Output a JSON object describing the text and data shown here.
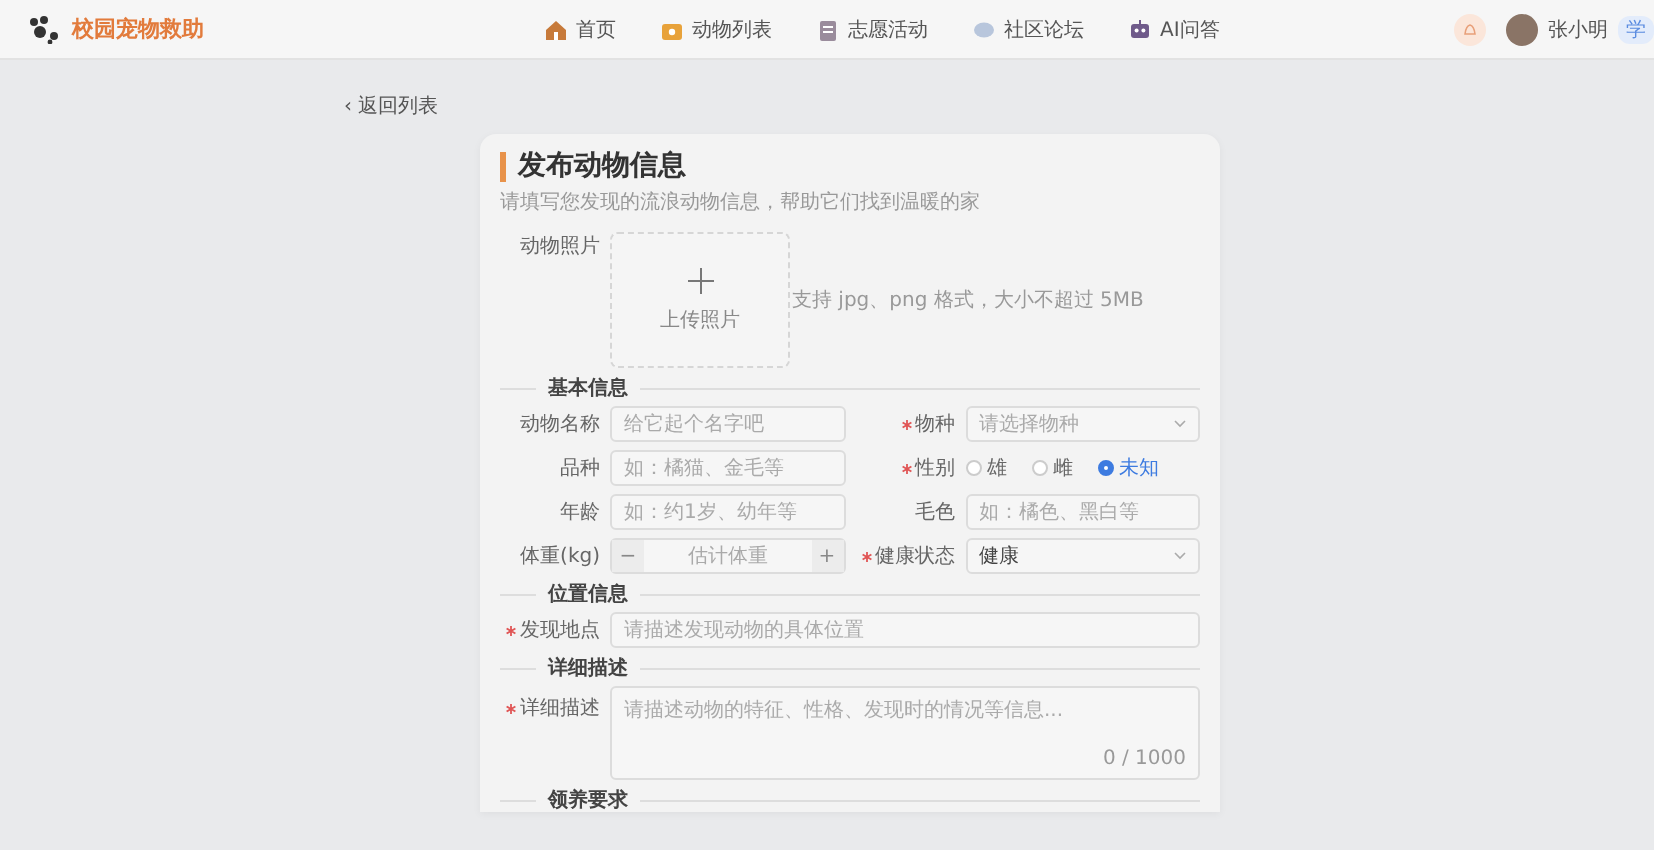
{
  "header": {
    "logo_text": "校园宠物救助",
    "nav": [
      {
        "label": "首页",
        "selected": false
      },
      {
        "label": "动物列表",
        "selected": false
      },
      {
        "label": "志愿活动",
        "selected": false
      },
      {
        "label": "社区论坛",
        "selected": false
      },
      {
        "label": "AI问答",
        "selected": false
      }
    ],
    "user_name": "张小明",
    "role_tag": "学"
  },
  "back_link": "‹ 返回列表",
  "form": {
    "title": "发布动物信息",
    "subtitle": "请填写您发现的流浪动物信息，帮助它们找到温暖的家",
    "photo": {
      "label": "动物照片",
      "upload_text": "上传照片",
      "hint": "支持 jpg、png 格式，大小不超过 5MB"
    },
    "sections": [
      {
        "title": "基本信息",
        "fields": [
          {
            "kind": "text",
            "label": "动物名称",
            "required": false,
            "placeholder": "给它起个名字吧"
          },
          {
            "kind": "select",
            "label": "物种",
            "required": true,
            "placeholder": "请选择物种"
          },
          {
            "kind": "text",
            "label": "品种",
            "required": false,
            "placeholder": "如：橘猫、金毛等"
          },
          {
            "kind": "radio",
            "label": "性别",
            "required": true,
            "options": [
              {
                "label": "雄",
                "selected": false
              },
              {
                "label": "雌",
                "selected": false
              },
              {
                "label": "未知",
                "selected": true
              }
            ]
          },
          {
            "kind": "text",
            "label": "年龄",
            "required": false,
            "placeholder": "如：约1岁、幼年等"
          },
          {
            "kind": "text",
            "label": "毛色",
            "required": false,
            "placeholder": "如：橘色、黑白等"
          },
          {
            "kind": "number",
            "label": "体重(kg)",
            "required": false,
            "placeholder": "估计体重",
            "decrement": "−",
            "increment": "+"
          },
          {
            "kind": "select",
            "label": "健康状态",
            "required": true,
            "value": "健康"
          }
        ]
      },
      {
        "title": "位置信息",
        "fields": [
          {
            "kind": "text",
            "label": "发现地点",
            "required": true,
            "placeholder": "请描述发现动物的具体位置"
          }
        ]
      },
      {
        "title": "详细描述",
        "fields": [
          {
            "kind": "textarea",
            "label": "详细描述",
            "required": true,
            "placeholder": "请描述动物的特征、性格、发现时的情况等信息...",
            "counter": "0 / 1000"
          }
        ]
      },
      {
        "title": "领养要求"
      }
    ]
  }
}
